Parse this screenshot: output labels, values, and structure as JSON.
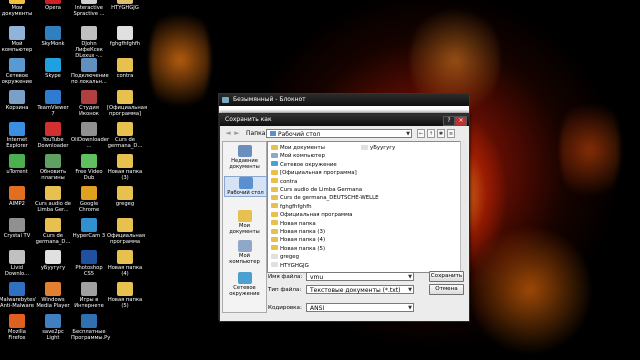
{
  "desktop": {
    "icons": [
      {
        "label": "Мои\nдокументы",
        "color": "#f0c040"
      },
      {
        "label": "Opera",
        "color": "#d02020"
      },
      {
        "label": "Interactive\nSpractive ...",
        "color": "#d0d0d0"
      },
      {
        "label": "HTYGHGJG",
        "color": "#e0c070"
      },
      {
        "label": "Мой\nкомпьютер",
        "color": "#8fb3d9"
      },
      {
        "label": "SkyMonk",
        "color": "#3080c0"
      },
      {
        "label": "DJohn ЛифеКсек\nDLexus -...",
        "color": "#c0c0c0"
      },
      {
        "label": "fghgfhfghfh",
        "color": "#e0e0e0"
      },
      {
        "label": "Сетевое\nокружение",
        "color": "#5a9ad0"
      },
      {
        "label": "Skype",
        "color": "#1fa0e0"
      },
      {
        "label": "Подключение\nпо локальн...",
        "color": "#6090c0"
      },
      {
        "label": "contra",
        "color": "#e8c050"
      },
      {
        "label": "Корзина",
        "color": "#7aa0c8"
      },
      {
        "label": "TeamViewer 7",
        "color": "#2f7bd0"
      },
      {
        "label": "Студия\nИконок",
        "color": "#b04040"
      },
      {
        "label": "[Официальная\nпрограмма]",
        "color": "#e8c050"
      },
      {
        "label": "Internet\nExplorer",
        "color": "#3a8fe0"
      },
      {
        "label": "YouTube\nDownloader",
        "color": "#d03030"
      },
      {
        "label": "OliDownloader\n...",
        "color": "#909090"
      },
      {
        "label": "Curs de\ngermana_D...",
        "color": "#e8c050"
      },
      {
        "label": "uTorrent",
        "color": "#4caf50"
      },
      {
        "label": "Обновить\nплагины",
        "color": "#60a060"
      },
      {
        "label": "Free Video\nDub",
        "color": "#60c060"
      },
      {
        "label": "Новая папка\n(3)",
        "color": "#e8c050"
      },
      {
        "label": "AIMP2",
        "color": "#e07020"
      },
      {
        "label": "Curs audio de\nLimba Ger...",
        "color": "#e8c050"
      },
      {
        "label": "Google\nChrome",
        "color": "#e0a020"
      },
      {
        "label": "gregeg",
        "color": "#e8c050"
      },
      {
        "label": "Crystal TV",
        "color": "#909090"
      },
      {
        "label": "Curs de\ngermana_D...",
        "color": "#e8c050"
      },
      {
        "label": "HyperCam 3",
        "color": "#3090d0"
      },
      {
        "label": "Официальная\nпрограмма",
        "color": "#e8c050"
      },
      {
        "label": "Livid\nDownlo...",
        "color": "#c0c0c0"
      },
      {
        "label": "уБуугугу",
        "color": "#e0e0e0"
      },
      {
        "label": "Photoshop\nCS5",
        "color": "#2050a0"
      },
      {
        "label": "Новая папка\n(4)",
        "color": "#e8c050"
      },
      {
        "label": "Malwarebytes'\nAnti-Malware",
        "color": "#3070c0"
      },
      {
        "label": "Windows\nMedia Player",
        "color": "#e08030"
      },
      {
        "label": "Игры в\nИнтернете",
        "color": "#a0a0a0"
      },
      {
        "label": "Новая папка\n(5)",
        "color": "#e8c050"
      },
      {
        "label": "Mozilla Firefox",
        "color": "#e06020"
      },
      {
        "label": "save2pc Light",
        "color": "#4080c0"
      },
      {
        "label": "Бесплатные\nПрограммы.Ру",
        "color": "#3070b0"
      }
    ]
  },
  "notepad": {
    "title": "Безымянный - Блокнот"
  },
  "dialog": {
    "title": "Сохранить как",
    "folder_label": "Папка:",
    "folder_value": "Рабочий стол",
    "close_label": "×",
    "help_label": "?",
    "toolbar_icons": [
      "←",
      "↑",
      "✱",
      "≡"
    ],
    "places": [
      {
        "label": "Недавние\nдокументы",
        "color": "#6a8fbf"
      },
      {
        "label": "Рабочий стол",
        "color": "#5a8fd0"
      },
      {
        "label": "Мои документы",
        "color": "#e8c050"
      },
      {
        "label": "Мой\nкомпьютер",
        "color": "#8fa8c8"
      },
      {
        "label": "Сетевое\nокружение",
        "color": "#4aa0d0"
      }
    ],
    "files_col1": [
      {
        "name": "Мои документы",
        "color": "#e8c050"
      },
      {
        "name": "Мой компьютер",
        "color": "#8fa8c8"
      },
      {
        "name": "Сетевое окружение",
        "color": "#4aa0d0"
      },
      {
        "name": "[Официальная программа]",
        "color": "#e8c050"
      },
      {
        "name": "contra",
        "color": "#e8c050"
      },
      {
        "name": "Curs audio de Limba Germana",
        "color": "#e8c050"
      },
      {
        "name": "Curs de germana_DEUTSCHE-WELLE",
        "color": "#e8c050"
      },
      {
        "name": "fghgfhfghfh",
        "color": "#e8c050"
      },
      {
        "name": "Официальная программа",
        "color": "#e8c050"
      },
      {
        "name": "Новая папка",
        "color": "#e8c050"
      },
      {
        "name": "Новая папка (3)",
        "color": "#e8c050"
      },
      {
        "name": "Новая папка (4)",
        "color": "#e8c050"
      },
      {
        "name": "Новая папка (5)",
        "color": "#e8c050"
      },
      {
        "name": "gregeg",
        "color": "#e0e0e0"
      },
      {
        "name": "HTYGHGJG",
        "color": "#e0e0e0"
      }
    ],
    "files_col2": [
      {
        "name": "уБуугугу",
        "color": "#e0e0e0"
      }
    ],
    "filename_label": "Имя файла:",
    "filename_value": "vmu",
    "filetype_label": "Тип файла:",
    "filetype_value": "Текстовые документы (*.txt)",
    "encoding_label": "Кодировка:",
    "encoding_value": "ANSI",
    "save_button": "Сохранить",
    "cancel_button": "Отмена"
  }
}
